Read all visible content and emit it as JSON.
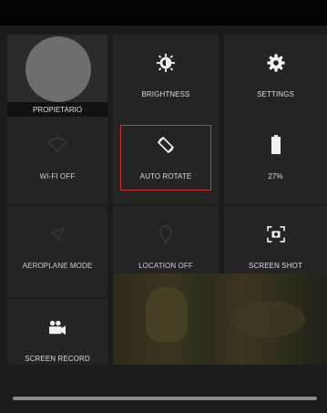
{
  "tiles": {
    "user": {
      "label": "PROPIETARIO"
    },
    "brightness": {
      "label": "BRIGHTNESS",
      "icon": "brightness-icon"
    },
    "settings": {
      "label": "SETTINGS",
      "icon": "gear-icon"
    },
    "wifi": {
      "label": "WI-FI OFF",
      "icon": "wifi-off-icon"
    },
    "auto_rotate": {
      "label": "AUTO ROTATE",
      "icon": "auto-rotate-icon",
      "highlighted": true
    },
    "battery": {
      "label": "27%",
      "icon": "battery-icon",
      "level": 0.27
    },
    "aeroplane": {
      "label": "AEROPLANE MODE",
      "icon": "airplane-icon"
    },
    "location": {
      "label": "LOCATION OFF",
      "icon": "location-off-icon"
    },
    "screenshot": {
      "label": "SCREEN SHOT",
      "icon": "screenshot-icon"
    },
    "screen_record": {
      "label": "SCREEN RECORD",
      "icon": "video-camera-icon"
    }
  },
  "colors": {
    "highlight_border": "#d03030",
    "panel": "#1b1b1b",
    "tile": "#242424"
  }
}
